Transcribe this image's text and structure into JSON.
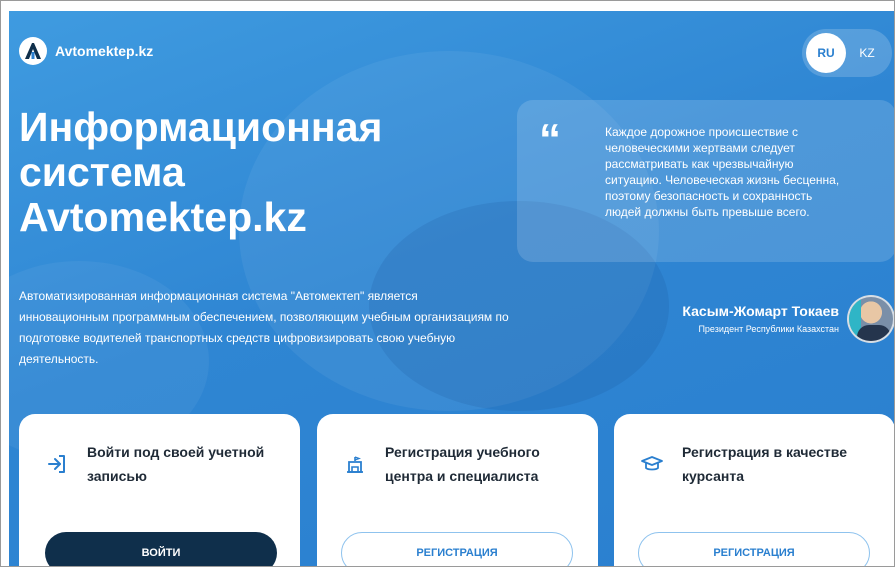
{
  "header": {
    "logo_text": "Avtomektep.kz",
    "lang": {
      "active": "RU",
      "other": "KZ"
    }
  },
  "hero": {
    "title": "Информационная система Avtomektep.kz",
    "description": "Автоматизированная информационная система \"Автомектеп\" является инновационным программным обеспечением, позволяющим учебным организациям по подготовке водителей транспортных средств цифровизировать свою учебную деятельность."
  },
  "quote": {
    "mark": "“",
    "text": "Каждое дорожное происшествие с человеческими жертвами следует рассматривать как чрезвычайную ситуацию. Человеческая жизнь бесценна, поэтому безопасность и сохранность людей должны быть превыше всего.",
    "author_name": "Касым-Жомарт Токаев",
    "author_role": "Президент Республики Казахстан"
  },
  "cards": [
    {
      "title": "Войти под своей учетной записью",
      "button": "ВОЙТИ",
      "icon": "login-icon"
    },
    {
      "title": "Регистрация учебного центра и специалиста",
      "button": "РЕГИСТРАЦИЯ",
      "icon": "building-icon"
    },
    {
      "title": "Регистрация в качестве курсанта",
      "button": "РЕГИСТРАЦИЯ",
      "icon": "graduation-cap-icon"
    }
  ],
  "colors": {
    "hero_blue": "#2f86d3",
    "dark_button": "#0f2f4b",
    "accent": "#2a7fcf",
    "text_dark": "#1f2a36"
  }
}
